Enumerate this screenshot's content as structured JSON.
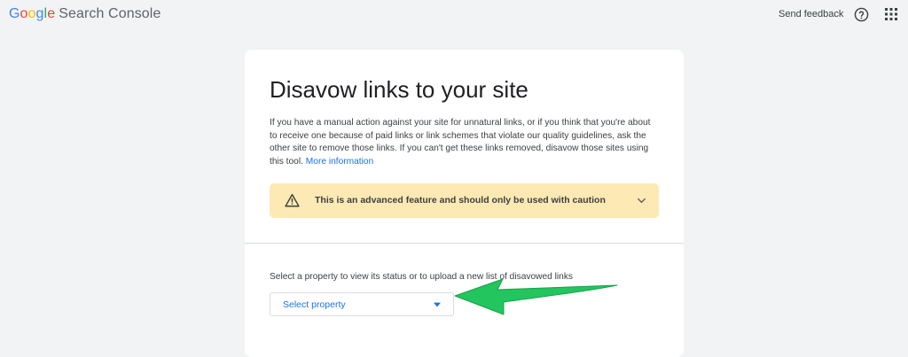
{
  "header": {
    "logo_letters": [
      "G",
      "o",
      "o",
      "g",
      "l",
      "e"
    ],
    "product_name": "Search Console",
    "feedback_label": "Send feedback",
    "help_icon": "help-circle-icon",
    "apps_icon": "apps-grid-icon"
  },
  "card": {
    "title": "Disavow links to your site",
    "description": "If you have a manual action against your site for unnatural links, or if you think that you're about to receive one because of paid links or link schemes that violate our quality guidelines, ask the other site to remove those links. If you can't get these links removed, disavow those sites using this tool.",
    "more_info_link": "More information",
    "warning": {
      "text": "This is an advanced feature and should only be used with caution",
      "icon": "warning-triangle-icon",
      "chevron": "chevron-down-icon"
    },
    "select_label": "Select a property to view its status or to upload a new list of disavowed links",
    "select": {
      "value": "Select property",
      "icon": "dropdown-caret-icon"
    }
  },
  "colors": {
    "background": "#f1f3f4",
    "card": "#ffffff",
    "warning_bg": "#fde9b3",
    "link_blue": "#1a73e8",
    "annotation_green": "#22c55e"
  }
}
